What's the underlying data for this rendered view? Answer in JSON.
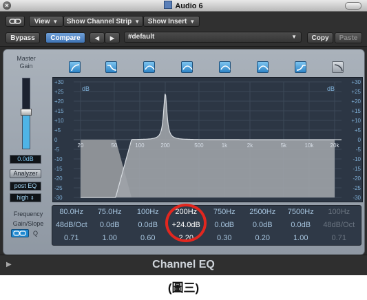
{
  "window": {
    "title": "Audio 6"
  },
  "toolbar": {
    "view_label": "View",
    "channel_strip_label": "Show Channel Strip",
    "insert_label": "Show Insert",
    "bypass_label": "Bypass",
    "compare_label": "Compare",
    "prev_label": "◀",
    "next_label": "▶",
    "preset_value": "#default",
    "copy_label": "Copy",
    "paste_label": "Paste"
  },
  "left_panel": {
    "master_gain_label": "Master\nGain",
    "master_gain_value": "0.0dB",
    "analyzer_label": "Analyzer",
    "analyzer_mode": "post EQ",
    "resolution": "high",
    "frequency_label": "Frequency",
    "gain_slope_label": "Gain/Slope",
    "q_label": "Q"
  },
  "band_buttons": [
    {
      "icon": "lowcut-icon",
      "active": true
    },
    {
      "icon": "lowshelf-icon",
      "active": true
    },
    {
      "icon": "bell-icon",
      "active": true
    },
    {
      "icon": "bell-icon",
      "active": true
    },
    {
      "icon": "bell-icon",
      "active": true
    },
    {
      "icon": "bell-icon",
      "active": true
    },
    {
      "icon": "highshelf-icon",
      "active": true
    },
    {
      "icon": "highcut-icon",
      "active": false
    }
  ],
  "graph": {
    "db_label": "dB",
    "y_ticks": [
      "+30",
      "+25",
      "+20",
      "+15",
      "+10",
      "+5",
      "0",
      "-5",
      "-10",
      "-15",
      "-20",
      "-25",
      "-30"
    ],
    "x_ticks": [
      "20",
      "50",
      "100",
      "200",
      "500",
      "1k",
      "2k",
      "5k",
      "10k",
      "20k"
    ]
  },
  "bands": [
    {
      "freq": "80.0Hz",
      "gain": "48dB/Oct",
      "q": "0.71"
    },
    {
      "freq": "75.0Hz",
      "gain": "0.0dB",
      "q": "1.00"
    },
    {
      "freq": "100Hz",
      "gain": "0.0dB",
      "q": "0.60"
    },
    {
      "freq": "200Hz",
      "gain": "+24.0dB",
      "q": "2.20"
    },
    {
      "freq": "750Hz",
      "gain": "0.0dB",
      "q": "0.30"
    },
    {
      "freq": "2500Hz",
      "gain": "0.0dB",
      "q": "0.20"
    },
    {
      "freq": "7500Hz",
      "gain": "0.0dB",
      "q": "1.00"
    },
    {
      "freq": "100Hz",
      "gain": "48dB/Oct",
      "q": "0.71"
    }
  ],
  "footer": {
    "plugin_name": "Channel EQ"
  },
  "caption": "(圖三)",
  "colors": {
    "accent": "#4fb4e6",
    "highlight_ring": "#e2271f"
  }
}
